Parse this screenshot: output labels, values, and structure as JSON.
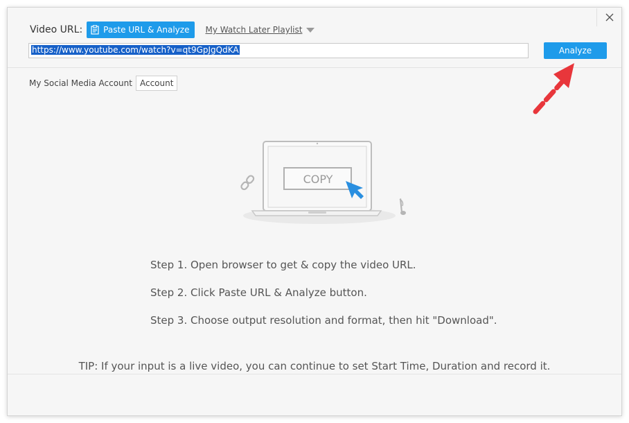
{
  "header": {
    "video_url_label": "Video URL:",
    "paste_button_label": "Paste URL & Analyze",
    "playlist_link_label": "My Watch Later Playlist"
  },
  "url_input": {
    "value": "https://www.youtube.com/watch?v=qt9GpJgQdKA"
  },
  "analyze_button_label": "Analyze",
  "account": {
    "label": "My Social Media Account",
    "button_label": "Account"
  },
  "illustration": {
    "copy_label": "COPY"
  },
  "steps": [
    "Step 1. Open browser to get & copy the video URL.",
    "Step 2. Click Paste URL & Analyze button.",
    "Step 3. Choose output resolution and format, then hit \"Download\"."
  ],
  "tip": "TIP: If your input is a live video, you can continue to set Start Time, Duration and record it.",
  "colors": {
    "accent": "#1e9bea",
    "selection": "#1660c8",
    "annotation_arrow": "#e8363b"
  },
  "icons": {
    "close": "close-icon",
    "clipboard": "clipboard-icon",
    "dropdown": "caret-down-icon",
    "link": "link-icon",
    "cursor": "cursor-arrow-icon",
    "music": "music-note-icon"
  }
}
